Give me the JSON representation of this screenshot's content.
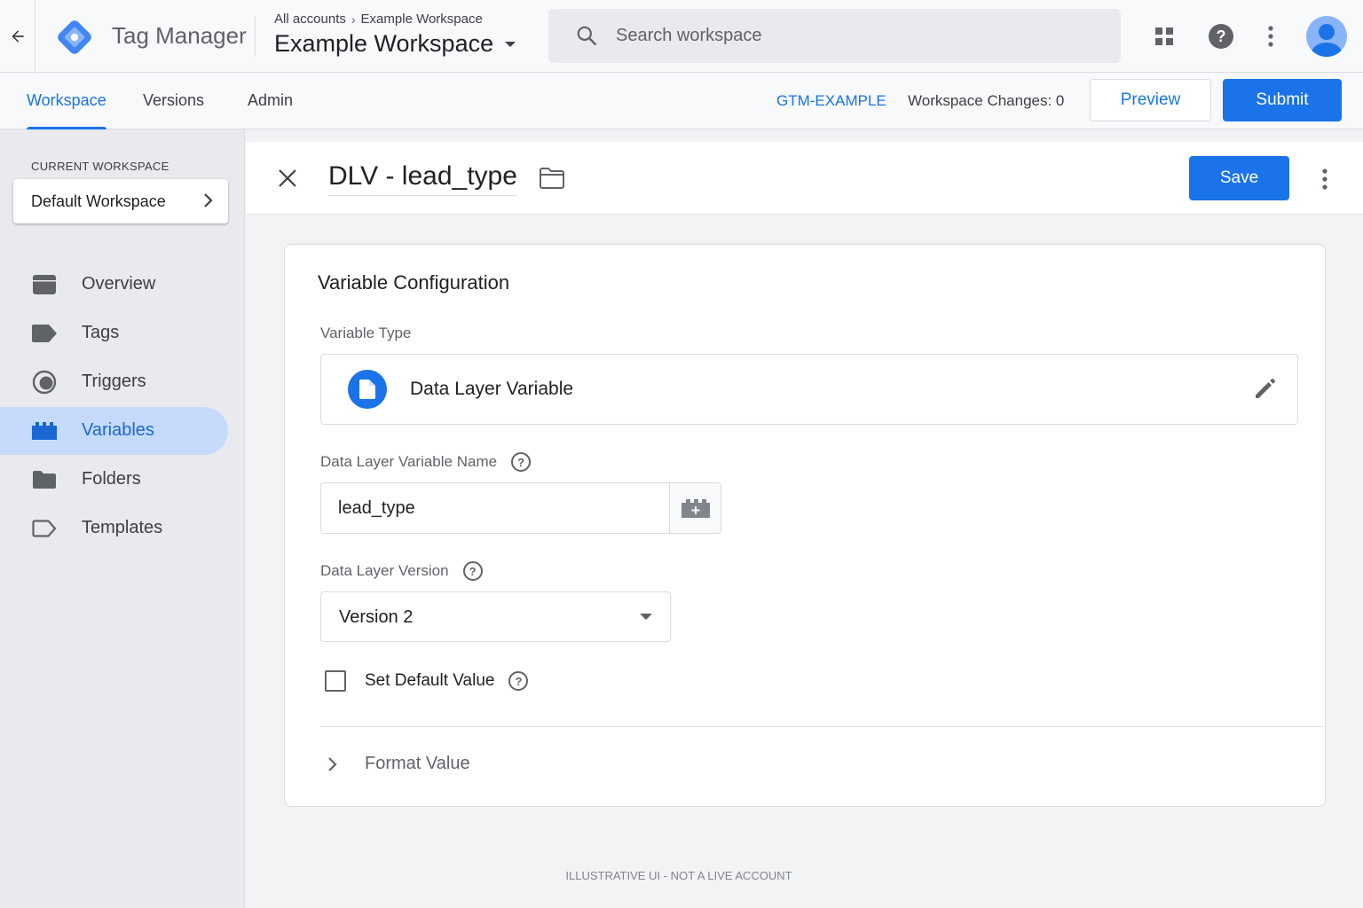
{
  "header": {
    "product_name": "Tag Manager",
    "breadcrumb": {
      "account": "All accounts",
      "workspace": "Example Workspace"
    },
    "container_title": "Example Workspace",
    "search_placeholder": "Search workspace"
  },
  "nav": {
    "tabs": [
      {
        "label": "Workspace",
        "active": true
      },
      {
        "label": "Versions",
        "active": false
      },
      {
        "label": "Admin",
        "active": false
      }
    ],
    "container_id": "GTM-EXAMPLE",
    "workspace_changes": "Workspace Changes: 0",
    "preview_label": "Preview",
    "submit_label": "Submit"
  },
  "sidebar": {
    "current_workspace_label": "CURRENT WORKSPACE",
    "current_workspace": "Default Workspace",
    "items": [
      {
        "label": "Overview",
        "icon": "overview-icon",
        "active": false
      },
      {
        "label": "Tags",
        "icon": "tag-icon",
        "active": false
      },
      {
        "label": "Triggers",
        "icon": "trigger-icon",
        "active": false
      },
      {
        "label": "Variables",
        "icon": "variable-icon",
        "active": true
      },
      {
        "label": "Folders",
        "icon": "folder-icon",
        "active": false
      },
      {
        "label": "Templates",
        "icon": "template-icon",
        "active": false
      }
    ]
  },
  "editor": {
    "variable_name": "DLV - lead_type",
    "save_label": "Save",
    "card_title": "Variable Configuration",
    "variable_type_label": "Variable Type",
    "variable_type": "Data Layer Variable",
    "dlv_name_label": "Data Layer Variable Name",
    "dlv_name_value": "lead_type",
    "dl_version_label": "Data Layer Version",
    "dl_version_value": "Version 2",
    "default_value_label": "Set Default Value",
    "default_value_checked": false,
    "format_value_label": "Format Value"
  },
  "footer_note": "ILLUSTRATIVE UI - NOT A LIVE ACCOUNT",
  "colors": {
    "accent": "#1a73e8",
    "active_nav_bg": "#c6dafc",
    "sidebar_bg": "#e8eaed",
    "page_bg": "#f1f3f4"
  }
}
